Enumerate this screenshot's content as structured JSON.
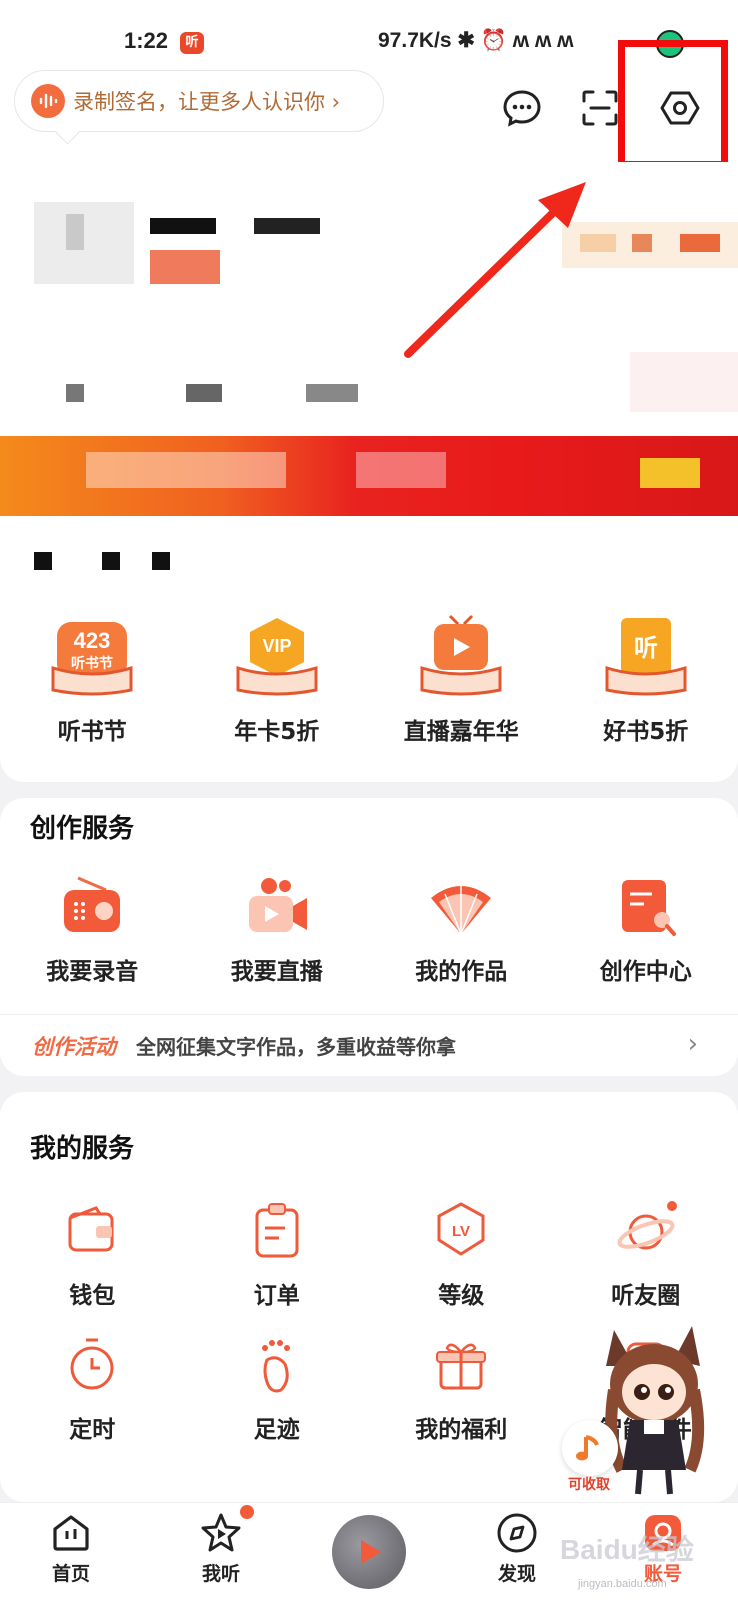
{
  "status_bar": {
    "time": "1:22",
    "app_badge": "听",
    "network_speed": "97.7K/s"
  },
  "header": {
    "signature_prompt": "录制签名，让更多人认识你 ›",
    "icons": [
      "chat-icon",
      "scan-icon",
      "settings-icon"
    ]
  },
  "quick_actions": [
    {
      "label": "听书节",
      "icon": "festival-423-icon",
      "badge": "423"
    },
    {
      "label": "年卡5折",
      "icon": "vip-book-icon",
      "badge": "VIP"
    },
    {
      "label": "直播嘉年华",
      "icon": "live-tv-icon"
    },
    {
      "label": "好书5折",
      "icon": "good-book-icon",
      "badge": "听"
    }
  ],
  "creation_services": {
    "title": "创作服务",
    "items": [
      {
        "label": "我要录音",
        "icon": "radio-icon"
      },
      {
        "label": "我要直播",
        "icon": "video-camera-icon"
      },
      {
        "label": "我的作品",
        "icon": "fan-icon"
      },
      {
        "label": "创作中心",
        "icon": "creation-doc-icon"
      }
    ],
    "activity": {
      "tag": "创作活动",
      "text": "全网征集文字作品，多重收益等你拿"
    }
  },
  "my_services": {
    "title": "我的服务",
    "row1": [
      {
        "label": "钱包",
        "icon": "wallet-icon"
      },
      {
        "label": "订单",
        "icon": "order-clipboard-icon"
      },
      {
        "label": "等级",
        "icon": "level-badge-icon",
        "badge": "LV"
      },
      {
        "label": "听友圈",
        "icon": "planet-icon"
      }
    ],
    "row2": [
      {
        "label": "定时",
        "icon": "timer-icon"
      },
      {
        "label": "足迹",
        "icon": "footprint-icon"
      },
      {
        "label": "我的福利",
        "icon": "gift-icon"
      },
      {
        "label": "智能硬件",
        "icon": "smart-hardware-icon"
      }
    ]
  },
  "floating": {
    "claim_label": "可收取"
  },
  "bottom_nav": [
    {
      "label": "首页",
      "icon": "home-icon"
    },
    {
      "label": "我听",
      "icon": "star-play-icon"
    },
    {
      "label": "",
      "icon": "center-play-icon"
    },
    {
      "label": "发现",
      "icon": "discover-icon"
    },
    {
      "label": "账号",
      "icon": "account-icon"
    }
  ],
  "watermark": {
    "text": "Baidu经验",
    "sub": "jingyan.baidu.com"
  },
  "colors": {
    "accent": "#f25a3a",
    "highlight": "#f20d0d"
  }
}
